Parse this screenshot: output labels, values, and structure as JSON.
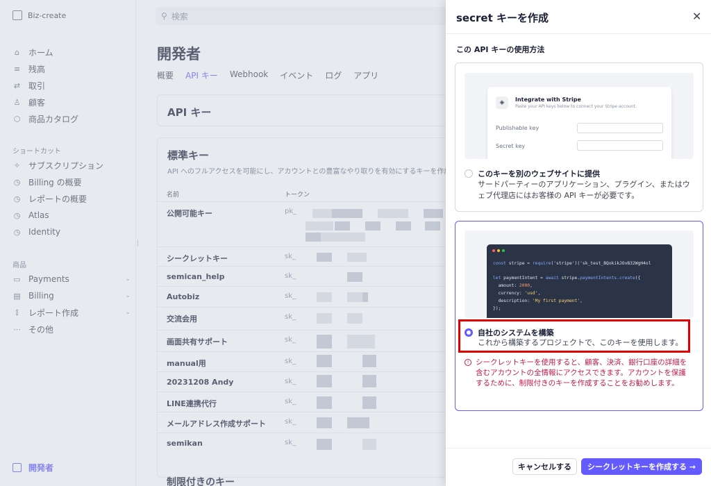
{
  "sidebar": {
    "brand": "Biz-create",
    "main_items": [
      {
        "label": "ホーム",
        "icon": "home-icon"
      },
      {
        "label": "残高",
        "icon": "balance-icon"
      },
      {
        "label": "取引",
        "icon": "transactions-icon"
      },
      {
        "label": "顧客",
        "icon": "customers-icon"
      },
      {
        "label": "商品カタログ",
        "icon": "catalog-icon"
      }
    ],
    "shortcuts_label": "ショートカット",
    "shortcuts": [
      {
        "label": "サブスクリプション",
        "icon": "pin-icon"
      },
      {
        "label": "Billing の概要",
        "icon": "clock-icon"
      },
      {
        "label": "レポートの概要",
        "icon": "clock-icon"
      },
      {
        "label": "Atlas",
        "icon": "clock-icon"
      },
      {
        "label": "Identity",
        "icon": "clock-icon"
      }
    ],
    "products_label": "商品",
    "products": [
      {
        "label": "Payments",
        "icon": "payments-icon"
      },
      {
        "label": "Billing",
        "icon": "billing-icon"
      },
      {
        "label": "レポート作成",
        "icon": "reports-icon"
      },
      {
        "label": "その他",
        "icon": "more-icon"
      }
    ],
    "developer": "開発者"
  },
  "main": {
    "search_placeholder": "検索",
    "page_title": "開発者",
    "tabs": [
      "概要",
      "API キー",
      "Webhook",
      "イベント",
      "ログ",
      "アプリ"
    ],
    "active_tab": "API キー",
    "api_card_title": "API キー",
    "standard_title": "標準キー",
    "standard_sub": "API へのフルアクセスを可能にし、アカウントとの豊富なやり取りを有効にするキーを作成します",
    "col_name": "名前",
    "col_token": "トークン",
    "rows": [
      {
        "name": "公開可能キー",
        "token": "pk_"
      },
      {
        "name": "シークレットキー",
        "token": "sk_"
      },
      {
        "name": "semican_help",
        "token": "sk_"
      },
      {
        "name": "Autobiz",
        "token": "sk_"
      },
      {
        "name": "交流会用",
        "token": "sk_"
      },
      {
        "name": "画面共有サポート",
        "token": "sk_"
      },
      {
        "name": "manual用",
        "token": "sk_"
      },
      {
        "name": "20231208 Andy",
        "token": "sk_"
      },
      {
        "name": "LINE連携代行",
        "token": "sk_"
      },
      {
        "name": "メールアドレス作成サポート",
        "token": "sk_"
      },
      {
        "name": "semikan",
        "token": "sk_"
      }
    ],
    "restricted_title": "制限付きのキー"
  },
  "drawer": {
    "title": "secret キーを作成",
    "question": "この API キーの使用方法",
    "option1": {
      "preview_title": "Integrate with Stripe",
      "preview_sub": "Paste your API keys below to connect your Stripe account.",
      "preview_label1": "Publishable key",
      "preview_label2": "Secret key",
      "title": "このキーを別のウェブサイトに提供",
      "desc": "サードパーティーのアプリケーション、プラグイン、またはウェブ代理店にはお客様の API キーが必要です。"
    },
    "option2": {
      "code": {
        "l1a": "const",
        "l1b": " stripe = ",
        "l1c": "require",
        "l1d": "('stripe')('sk_test_BQokikJOvB32WgH4ol",
        "l2a": "let",
        "l2b": " paymentIntent = ",
        "l2c": "await",
        "l2d": " stripe.",
        "l2e": "paymentIntents.create",
        "l2f": "({",
        "l3a": "  amount: ",
        "l3b": "2000",
        "l3c": ",",
        "l4a": "  currency: ",
        "l4b": "'usd'",
        "l4c": ",",
        "l5a": "  description: ",
        "l5b": "'My first payment'",
        "l5c": ",",
        "l6": "});"
      },
      "title": "自社のシステムを構築",
      "desc": "これから構築するプロジェクトで、このキーを使用します。",
      "warning": "シークレットキーを使用すると、顧客、決済、銀行口座の詳細を含むアカウントの全情報にアクセスできます。アカウントを保護するために、制限付きのキーを作成することをお勧めします。"
    },
    "cancel": "キャンセルする",
    "create": "シークレットキーを作成する →"
  },
  "colors": {
    "accent": "#635bff",
    "highlight": "#e00000",
    "warning": "#c21c4b"
  }
}
